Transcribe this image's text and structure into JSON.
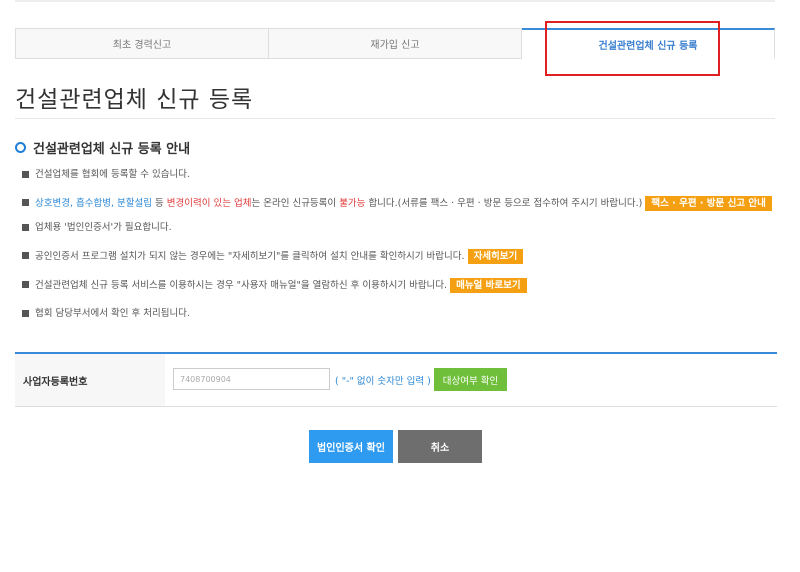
{
  "tabs": [
    {
      "label": "최초 경력신고"
    },
    {
      "label": "재가입 신고"
    },
    {
      "label": "건설관련업체 신규 등록"
    }
  ],
  "page_title": "건설관련업체 신규 등록",
  "section_title": "건설관련업체 신규 등록 안내",
  "notices": {
    "n1": "건설업체를 협회에 등록할 수 있습니다.",
    "n2_blue": "상호변경, 흡수합병, 분할설립",
    "n2_a": " 등 ",
    "n2_red1": "변경이력이 있는 업체",
    "n2_b": "는 온라인 신규등록이 ",
    "n2_red2": "불가능",
    "n2_c": " 합니다.(서류를 팩스 · 우편 · 방문 등으로 접수하여 주시기 바랍니다.) ",
    "n2_badge": "팩스 · 우편 · 방문 신고 안내",
    "n3": "업체용 '법인인증서'가 필요합니다.",
    "n4": "공인인증서 프로그램 설치가 되지 않는 경우에는 \"자세히보기\"를 클릭하여 설치 안내를 확인하시기 바랍니다. ",
    "n4_badge": "자세히보기",
    "n5": "건설관련업체 신규 등록 서비스를 이용하시는 경우 \"사용자 매뉴얼\"을 열람하신 후 이용하시기 바랍니다. ",
    "n5_badge": "매뉴얼 바로보기",
    "n6": "협회 담당부서에서 확인 후 처리됩니다."
  },
  "form": {
    "label": "사업자등록번호",
    "value": "7408700904",
    "hint": "( \"-\" 없이 숫자만 입력 )",
    "check_button": "대상여부 확인"
  },
  "buttons": {
    "confirm": "법인인증서 확인",
    "cancel": "취소"
  },
  "colors": {
    "accent": "#3a8ad8",
    "orange": "#f4a012",
    "green": "#6fbf3b",
    "red": "#e03b3b",
    "highlight_box": "#e02020"
  }
}
